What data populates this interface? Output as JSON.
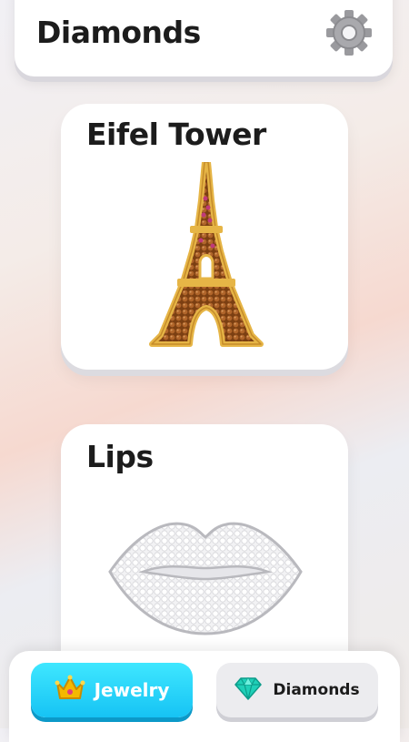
{
  "header": {
    "title": "Diamonds",
    "settings_icon": "gear-icon"
  },
  "cards": [
    {
      "title": "Eifel Tower",
      "image_icon": "eiffel-tower-art"
    },
    {
      "title": "Lips",
      "image_icon": "lips-art"
    }
  ],
  "bottom_nav": {
    "tabs": [
      {
        "label": "Jewelry",
        "icon": "crown-icon",
        "active": true
      },
      {
        "label": "Diamonds",
        "icon": "diamond-icon",
        "active": false
      }
    ]
  },
  "colors": {
    "active_tab": "#16c3f4",
    "inactive_tab": "#ececef",
    "bead_brown": "#a05a22",
    "gold": "#e6b546",
    "gem_teal": "#1fd0b8",
    "crown_gold": "#f5b800"
  }
}
